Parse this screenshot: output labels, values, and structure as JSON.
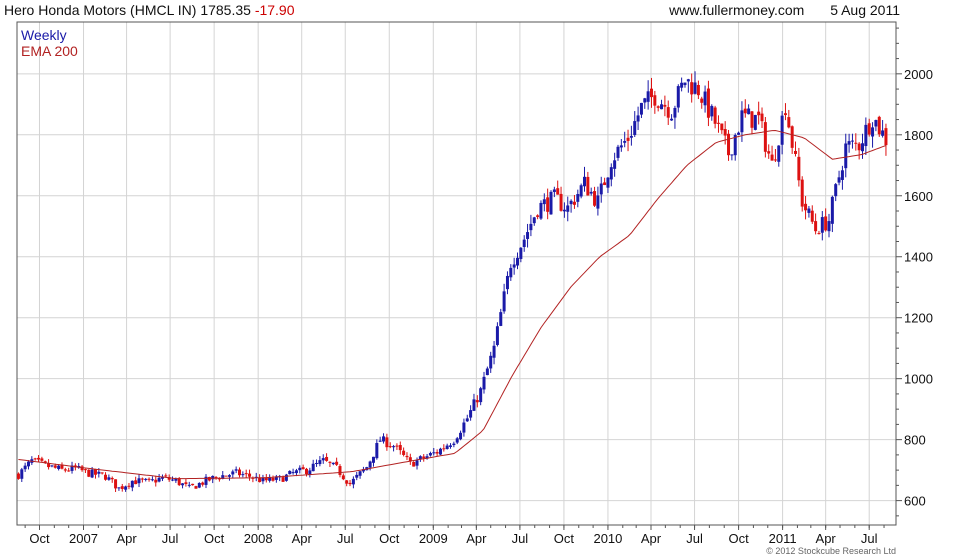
{
  "header": {
    "instrument": "Hero Honda Motors (HMCL IN)",
    "price": "1785.35",
    "change": "-17.90",
    "site": "www.fullermoney.com",
    "date": "5 Aug 2011"
  },
  "footer": {
    "copyright": "© 2012 Stockcube Research Ltd"
  },
  "chart_data": {
    "type": "candlestick",
    "title": "Hero Honda Motors (HMCL IN) 1785.35 -17.90",
    "legend": [
      "Weekly",
      "EMA 200"
    ],
    "legend_position": "top-left",
    "grid": true,
    "colors": {
      "up": "#1a1aa8",
      "down": "#dd1111",
      "ema": "#b22222",
      "grid": "#d4d4d4"
    },
    "ylim": [
      520,
      2170
    ],
    "y_ticks": [
      600,
      800,
      1000,
      1200,
      1400,
      1600,
      1800,
      2000
    ],
    "x_range": [
      "2006-08-15",
      "2011-08-26"
    ],
    "x_ticks": [
      {
        "label": "Oct",
        "date": "2006-10-01"
      },
      {
        "label": "2007",
        "date": "2007-01-01"
      },
      {
        "label": "Apr",
        "date": "2007-04-01"
      },
      {
        "label": "Jul",
        "date": "2007-07-01"
      },
      {
        "label": "Oct",
        "date": "2007-10-01"
      },
      {
        "label": "2008",
        "date": "2008-01-01"
      },
      {
        "label": "Apr",
        "date": "2008-04-01"
      },
      {
        "label": "Jul",
        "date": "2008-07-01"
      },
      {
        "label": "Oct",
        "date": "2008-10-01"
      },
      {
        "label": "2009",
        "date": "2009-01-01"
      },
      {
        "label": "Apr",
        "date": "2009-04-01"
      },
      {
        "label": "Jul",
        "date": "2009-07-01"
      },
      {
        "label": "Oct",
        "date": "2009-10-01"
      },
      {
        "label": "2010",
        "date": "2010-01-01"
      },
      {
        "label": "Apr",
        "date": "2010-04-01"
      },
      {
        "label": "Jul",
        "date": "2010-07-01"
      },
      {
        "label": "Oct",
        "date": "2010-10-01"
      },
      {
        "label": "2011",
        "date": "2011-01-01"
      },
      {
        "label": "Apr",
        "date": "2011-04-01"
      },
      {
        "label": "Jul",
        "date": "2011-07-01"
      }
    ],
    "weekly_close_anchors": [
      [
        "2006-08-18",
        685
      ],
      [
        "2006-09-15",
        730
      ],
      [
        "2006-10-13",
        715
      ],
      [
        "2006-11-17",
        700
      ],
      [
        "2006-12-15",
        705
      ],
      [
        "2007-01-12",
        690
      ],
      [
        "2007-02-16",
        680
      ],
      [
        "2007-03-16",
        640
      ],
      [
        "2007-04-13",
        665
      ],
      [
        "2007-05-18",
        660
      ],
      [
        "2007-06-15",
        675
      ],
      [
        "2007-07-13",
        665
      ],
      [
        "2007-08-10",
        640
      ],
      [
        "2007-09-14",
        665
      ],
      [
        "2007-10-12",
        680
      ],
      [
        "2007-11-16",
        690
      ],
      [
        "2007-12-14",
        680
      ],
      [
        "2008-01-11",
        665
      ],
      [
        "2008-02-15",
        670
      ],
      [
        "2008-03-14",
        690
      ],
      [
        "2008-04-11",
        700
      ],
      [
        "2008-05-16",
        730
      ],
      [
        "2008-06-13",
        705
      ],
      [
        "2008-07-11",
        655
      ],
      [
        "2008-08-15",
        710
      ],
      [
        "2008-09-12",
        800
      ],
      [
        "2008-10-10",
        780
      ],
      [
        "2008-11-14",
        720
      ],
      [
        "2008-12-12",
        740
      ],
      [
        "2009-01-09",
        760
      ],
      [
        "2009-02-13",
        800
      ],
      [
        "2009-03-13",
        870
      ],
      [
        "2009-04-10",
        960
      ],
      [
        "2009-05-08",
        1100
      ],
      [
        "2009-06-12",
        1380
      ],
      [
        "2009-07-10",
        1460
      ],
      [
        "2009-08-07",
        1560
      ],
      [
        "2009-09-11",
        1590
      ],
      [
        "2009-10-09",
        1560
      ],
      [
        "2009-11-13",
        1640
      ],
      [
        "2009-12-11",
        1580
      ],
      [
        "2010-01-08",
        1720
      ],
      [
        "2010-02-12",
        1790
      ],
      [
        "2010-03-12",
        1890
      ],
      [
        "2010-04-09",
        1930
      ],
      [
        "2010-05-14",
        1880
      ],
      [
        "2010-06-11",
        1980
      ],
      [
        "2010-07-09",
        1950
      ],
      [
        "2010-08-13",
        1840
      ],
      [
        "2010-09-10",
        1740
      ],
      [
        "2010-10-08",
        1860
      ],
      [
        "2010-11-12",
        1850
      ],
      [
        "2010-12-10",
        1700
      ],
      [
        "2011-01-07",
        1900
      ],
      [
        "2011-02-11",
        1580
      ],
      [
        "2011-03-11",
        1490
      ],
      [
        "2011-04-08",
        1520
      ],
      [
        "2011-05-13",
        1760
      ],
      [
        "2011-06-10",
        1770
      ],
      [
        "2011-07-08",
        1860
      ],
      [
        "2011-08-05",
        1785.35
      ]
    ],
    "ema200_anchors": [
      [
        "2006-08-18",
        735
      ],
      [
        "2007-01-15",
        705
      ],
      [
        "2007-07-15",
        672
      ],
      [
        "2008-01-15",
        675
      ],
      [
        "2008-07-15",
        695
      ],
      [
        "2008-11-15",
        730
      ],
      [
        "2009-02-15",
        755
      ],
      [
        "2009-04-15",
        830
      ],
      [
        "2009-06-15",
        1010
      ],
      [
        "2009-08-15",
        1170
      ],
      [
        "2009-10-15",
        1300
      ],
      [
        "2009-12-15",
        1400
      ],
      [
        "2010-02-15",
        1470
      ],
      [
        "2010-04-15",
        1590
      ],
      [
        "2010-06-15",
        1700
      ],
      [
        "2010-08-15",
        1775
      ],
      [
        "2010-10-15",
        1800
      ],
      [
        "2010-12-15",
        1815
      ],
      [
        "2011-02-15",
        1790
      ],
      [
        "2011-04-15",
        1720
      ],
      [
        "2011-06-15",
        1735
      ],
      [
        "2011-08-05",
        1765
      ]
    ]
  }
}
